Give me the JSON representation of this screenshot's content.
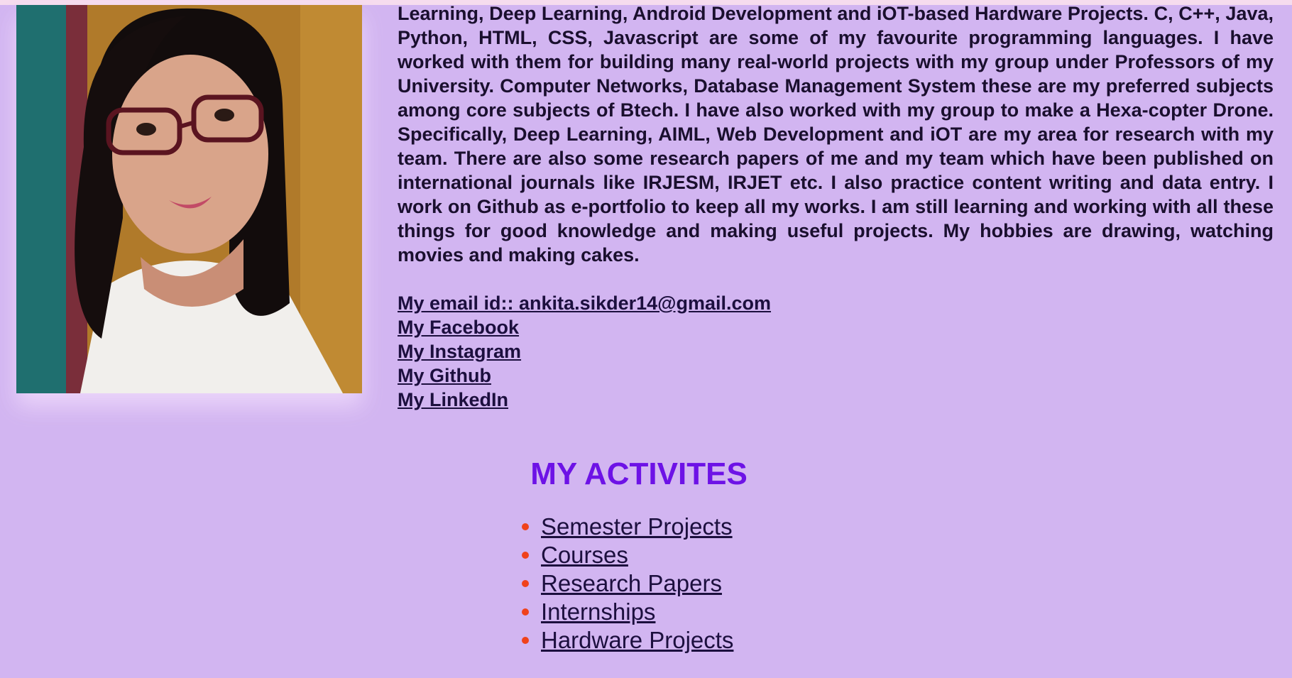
{
  "profile": {
    "photo_alt": "Profile photo",
    "about_text": "Learning, Deep Learning, Android Development and iOT-based Hardware Projects. C, C++, Java, Python, HTML, CSS, Javascript are some of my favourite programming languages. I have worked with them for building many real-world projects with my group under Professors of my University. Computer Networks, Database Management System these are my preferred subjects among core subjects of Btech. I have also worked with my group to make a Hexa-copter Drone. Specifically, Deep Learning, AIML, Web Development and iOT are my area for research with my team. There are also some research papers of me and my team which have been published on international journals like IRJESM, IRJET etc. I also practice content writing and data entry. I work on Github as e-portfolio to keep all my works. I am still learning and working with all these things for good knowledge and making useful projects. My hobbies are drawing, watching movies and making cakes."
  },
  "links": {
    "email": "My email id:: ankita.sikder14@gmail.com",
    "facebook": "My Facebook",
    "instagram": "My Instagram",
    "github": "My Github",
    "linkedin": "My LinkedIn"
  },
  "activities": {
    "title": "MY ACTIVITES",
    "items": [
      {
        "label": "Semester Projects"
      },
      {
        "label": "Courses"
      },
      {
        "label": "Research Papers"
      },
      {
        "label": "Internships"
      },
      {
        "label": "Hardware Projects"
      }
    ]
  },
  "colors": {
    "background": "#d2b5f1",
    "heading": "#6d12e6",
    "bullet": "#f0421b",
    "link": "#1c0f3e"
  }
}
